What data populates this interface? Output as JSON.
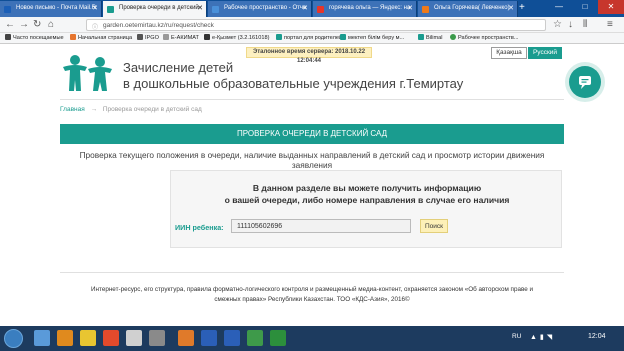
{
  "browser": {
    "tabs": [
      {
        "label": "Новое письмо - Почта Mail.R",
        "color": "#1b5fb7",
        "active": false
      },
      {
        "label": "Проверка очереди в детский",
        "color": "#1a9c8f",
        "active": true
      },
      {
        "label": "Рабочее пространство - Отче",
        "color": "#4a90d9",
        "active": false
      },
      {
        "label": "горячева ольга — Яндекс: на",
        "color": "#e8352a",
        "active": false
      },
      {
        "label": "Ольга Горячева( Левченко)",
        "color": "#ee7a1a",
        "active": false
      }
    ],
    "new_tab": "+",
    "window_controls": [
      "—",
      "□",
      "✕"
    ],
    "address": "garden.oetemirtau.kz/ru/request/check",
    "bookmarks": [
      {
        "label": "Часто посещаемые",
        "color": "#444"
      },
      {
        "label": "Начальная страница",
        "color": "#e6752e"
      },
      {
        "label": "IPGO",
        "color": "#555"
      },
      {
        "label": "E-АКИМАТ",
        "color": "#999"
      },
      {
        "label": "e-Қызмет (3.2.161018)",
        "color": "#333"
      },
      {
        "label": "портал для родителей",
        "color": "#1a9c8f"
      },
      {
        "label": "мектеп білім беру м...",
        "color": "#1a9c8f"
      },
      {
        "label": "Bilimal",
        "color": "#1a9c8f"
      },
      {
        "label": "Рабочее пространств...",
        "color": "#3a9a4a"
      }
    ]
  },
  "page": {
    "server_time": "Эталонное время сервера: 2018.10.22 12:04:44",
    "lang_kz": "Қазақша",
    "lang_ru": "Русский",
    "title_line1": "Зачисление детей",
    "title_line2": "в дошкольные образовательные учреждения г.Темиртау",
    "breadcrumb": {
      "home": "Главная",
      "sep": "→",
      "current": "Проверка очереди в детский сад"
    },
    "section_title": "ПРОВЕРКА ОЧЕРЕДИ В ДЕТСКИЙ САД",
    "section_subtitle": "Проверка текущего положения в очереди, наличие выданных направлений в детский сад и просмотр истории движения заявления",
    "info_line1": "В данном разделе вы можете получить информацию",
    "info_line2": "о вашей очереди, либо номере направления в случае его наличия",
    "iin_label": "ИИН ребенка:",
    "iin_value": "111105602696",
    "search_button": "Поиск",
    "footer_line1": "Интернет-ресурс, его структура, правила форматно-логического контроля и размещенный медиа-контент, охраняется законом «Об авторском праве и",
    "footer_line2": "смежных правах» Республики Казахстан. ТОО «КДС-Азия», 2016©"
  },
  "taskbar": {
    "apps": [
      "#5a9ad9",
      "#e08a1e",
      "#e8c531",
      "#e34a2c",
      "#d0d0d0",
      "#8a8a8a",
      "#4a7fd6",
      "#2b5fb8",
      "#3e9a4a",
      "#1e6fbf",
      "#2c8f3c"
    ],
    "lang": "RU",
    "time": "12:04"
  }
}
